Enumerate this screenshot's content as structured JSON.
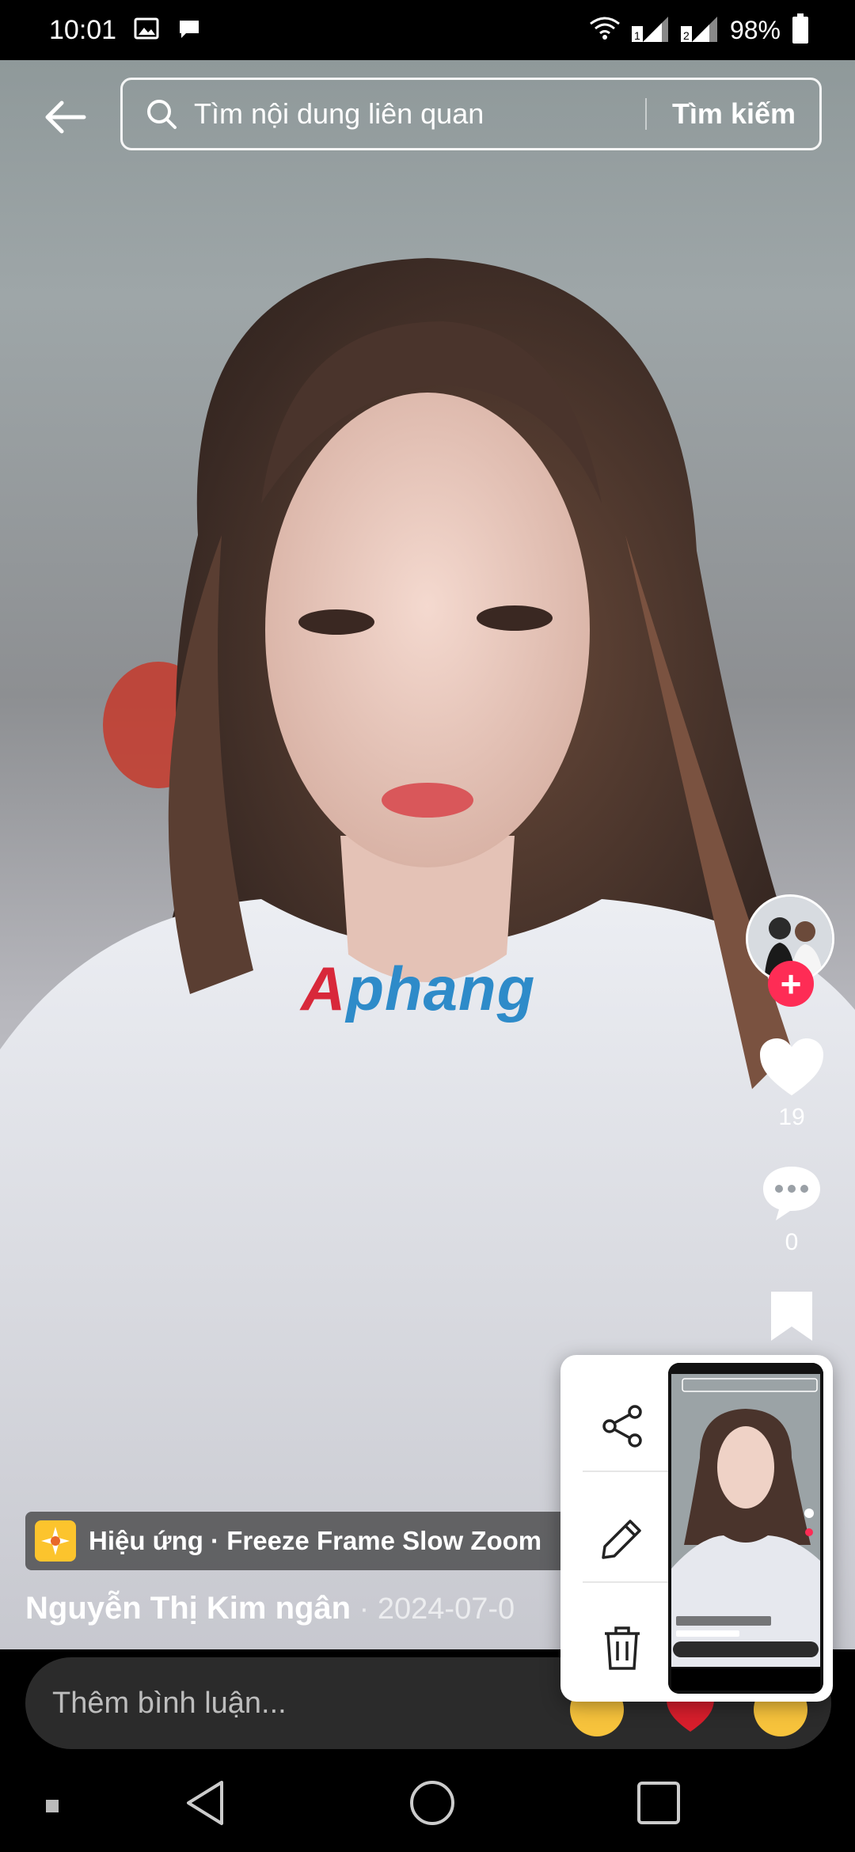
{
  "status_bar": {
    "time": "10:01",
    "battery": "98%",
    "icons": [
      "gallery-icon",
      "chat-bubble-icon",
      "wifi-icon",
      "signal-sim1-icon",
      "signal-sim2-icon",
      "battery-icon"
    ]
  },
  "top_bar": {
    "search_placeholder": "Tìm nội dung liên quan",
    "search_button": "Tìm kiếm"
  },
  "watermark": {
    "first": "A",
    "rest": "phang"
  },
  "actions": {
    "likes": "19",
    "comments": "0"
  },
  "effect": {
    "label": "Hiệu ứng · Freeze Frame Slow Zoom"
  },
  "author": {
    "name": "Nguyễn Thị Kim ngân",
    "date": " · 2024-07-0"
  },
  "comment_bar": {
    "placeholder": "Thêm bình luận..."
  },
  "popup": {
    "actions": [
      "share-icon",
      "edit-icon",
      "delete-icon"
    ]
  },
  "colors": {
    "accent_red": "#fe2c55",
    "effect_yellow": "#fcc42d",
    "watermark_red": "#d8283a",
    "watermark_blue": "#2e8bc9"
  }
}
